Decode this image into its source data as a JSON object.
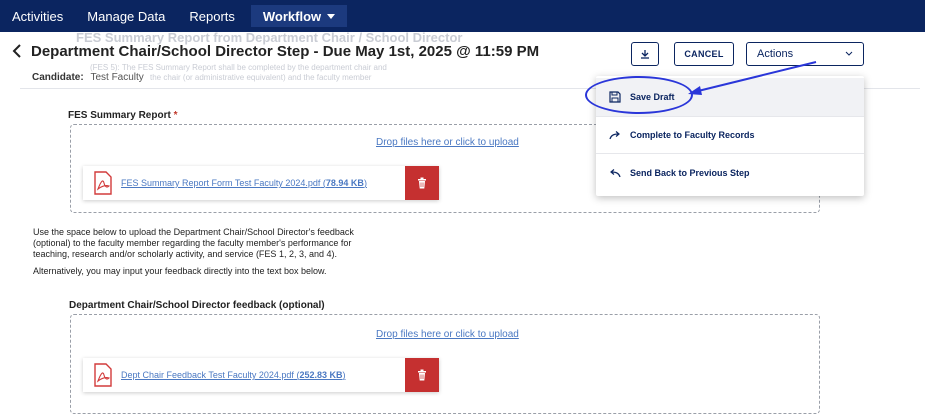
{
  "nav": {
    "items": [
      {
        "label": "Activities"
      },
      {
        "label": "Manage Data"
      },
      {
        "label": "Reports"
      },
      {
        "label": "Workflow"
      }
    ]
  },
  "ghost": {
    "heading": "FES Summary Report from Department Chair / School Director",
    "note_line1": "(FES 5): The FES Summary Report shall be completed by the department chair and",
    "note_line2": "the chair (or administrative equivalent) and the faculty member"
  },
  "header": {
    "title": "Department Chair/School Director Step - Due May 1st, 2025 @ 11:59 PM",
    "candidate_label": "Candidate:",
    "candidate_name": "Test Faculty"
  },
  "toolbar": {
    "cancel_label": "CANCEL",
    "actions_label": "Actions"
  },
  "menu": {
    "items": [
      {
        "label": "Save Draft",
        "icon": "save-icon"
      },
      {
        "label": "Complete to Faculty Records",
        "icon": "forward-arrow-icon"
      },
      {
        "label": "Send Back to Previous Step",
        "icon": "reply-icon"
      }
    ]
  },
  "fes_section": {
    "label": "FES Summary Report",
    "required_marker": "*",
    "dropzone_text": "Drop files here or click to upload",
    "file": {
      "name": "FES Summary Report Form Test Faculty 2024.pdf",
      "size": "78.94 KB"
    }
  },
  "instructions": {
    "line1": "Use the space below to upload the Department Chair/School Director's feedback",
    "line2": "(optional) to the faculty member regarding the faculty member's performance for",
    "line3": "teaching, research and/or scholarly activity, and service (FES 1, 2, 3, and 4).",
    "line4": "Alternatively, you may input your feedback directly into the text box below."
  },
  "feedback_section": {
    "label": "Department Chair/School Director feedback (optional)",
    "dropzone_text": "Drop files here or click to upload",
    "file": {
      "name": "Dept Chair Feedback Test Faculty 2024.pdf",
      "size": "252.83 KB"
    }
  },
  "colors": {
    "nav_bg": "#0b2560",
    "accent": "#0b2560",
    "danger": "#c53030",
    "link": "#4a78c2",
    "annotation": "#2a36d9"
  }
}
